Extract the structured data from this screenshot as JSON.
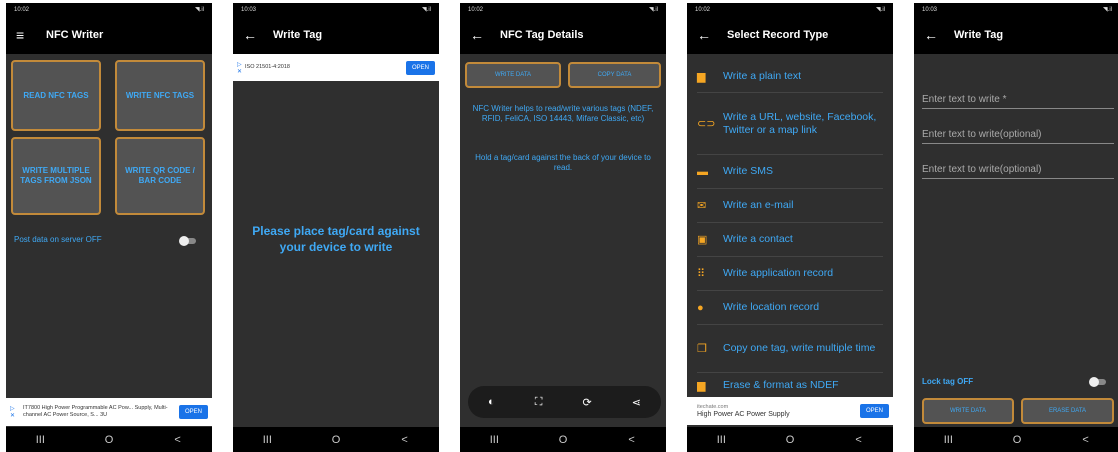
{
  "colors": {
    "accent": "#3fa9f5",
    "border": "#c28a3a",
    "record_icon": "#f5a623",
    "ad_button": "#1a73e8"
  },
  "nav": {
    "recent": "III",
    "home": "O",
    "back": "<"
  },
  "screens": [
    {
      "status_time": "10:02",
      "status_right": "◥.il",
      "toolbar_icon": "menu-icon",
      "title": "NFC Writer",
      "tiles": [
        "READ NFC TAGS",
        "WRITE NFC TAGS",
        "WRITE MULTIPLE TAGS FROM JSON",
        "WRITE QR CODE / BAR CODE"
      ],
      "post_data_label": "Post data on server OFF",
      "post_data_on": false,
      "ad": {
        "text": "IT7800 High Power Programmable AC Pow... Supply, Multi-channel AC Power Source, S... 3U",
        "button": "OPEN"
      }
    },
    {
      "status_time": "10:03",
      "status_right": "◥.il",
      "toolbar_icon": "back-arrow-icon",
      "title": "Write Tag",
      "ad": {
        "text": "ISO 21501-4:2018",
        "button": "OPEN"
      },
      "message": "Please place tag/card against your device to write"
    },
    {
      "status_time": "10:02",
      "status_right": "◥.il",
      "toolbar_icon": "back-arrow-icon",
      "title": "NFC Tag Details",
      "buttons": [
        "WRITE DATA",
        "COPY DATA"
      ],
      "info1": "NFC Writer helps to read/write various tags (NDEF, RFID, FeliCA, ISO 14443, Mifare Classic, etc)",
      "info2": "Hold a tag/card against the back of your device to read."
    },
    {
      "status_time": "10:02",
      "status_right": "◥.il",
      "toolbar_icon": "back-arrow-icon",
      "title": "Select Record Type",
      "records": [
        {
          "icon": "document-icon",
          "label": "Write a plain text"
        },
        {
          "icon": "link-icon",
          "label": "Write a URL, website, Facebook, Twitter or a map link"
        },
        {
          "icon": "sms-icon",
          "label": "Write SMS"
        },
        {
          "icon": "email-icon",
          "label": "Write an e-mail"
        },
        {
          "icon": "contact-icon",
          "label": "Write a contact"
        },
        {
          "icon": "apps-icon",
          "label": "Write application record"
        },
        {
          "icon": "location-icon",
          "label": "Write location record"
        },
        {
          "icon": "copy-icon",
          "label": "Copy one tag, write multiple time"
        },
        {
          "icon": "erase-icon",
          "label": "Erase & format as NDEF"
        }
      ],
      "ad": {
        "source": "itechate.com",
        "text": "High Power AC Power Supply",
        "button": "OPEN"
      }
    },
    {
      "status_time": "10:03",
      "status_right": "◥.il",
      "toolbar_icon": "back-arrow-icon",
      "title": "Write Tag",
      "fields": [
        "Enter text to write *",
        "Enter text to write(optional)",
        "Enter text to write(optional)"
      ],
      "lock_label": "Lock tag OFF",
      "lock_on": false,
      "buttons": [
        "WRITE DATA",
        "ERASE DATA"
      ]
    }
  ]
}
